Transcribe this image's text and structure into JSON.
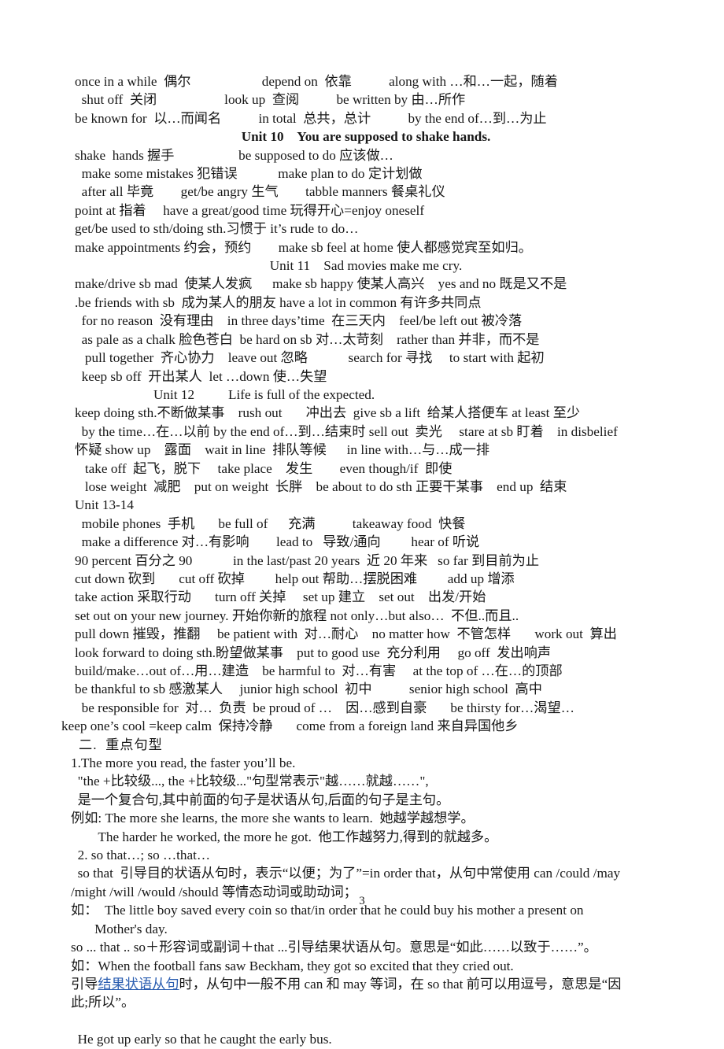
{
  "document": {
    "page_number": "3",
    "link_color": "#2a5db0",
    "text_color": "#171717"
  },
  "lines": [
    {
      "id": "l1",
      "text": "once in a while  偶尔                     depend on  依靠           along with …和…一起，随着"
    },
    {
      "id": "l2",
      "text": "  shut off  关闭                    look up  查阅           be written by 由…所作"
    },
    {
      "id": "l3",
      "text": "be known for  以…而闻名           in total  总共，总计           by the end of…到…为止"
    },
    {
      "id": "l4",
      "text": "Unit 10    You are supposed to shake hands."
    },
    {
      "id": "l5",
      "text": "shake  hands 握手                   be supposed to do 应该做…"
    },
    {
      "id": "l6",
      "text": "  make some mistakes 犯错误            make plan to do 定计划做"
    },
    {
      "id": "l7",
      "text": "  after all 毕竟        get/be angry 生气        tabble manners 餐桌礼仪"
    },
    {
      "id": "l8",
      "text": "point at 指着     have a great/good time 玩得开心=enjoy oneself"
    },
    {
      "id": "l9",
      "text": "get/be used to sth/doing sth.习惯于 it’s rude to do…"
    },
    {
      "id": "l10",
      "text": "make appointments 约会，预约        make sb feel at home 使人都感觉宾至如归。"
    },
    {
      "id": "l11",
      "text": "Unit 11    Sad movies make me cry."
    },
    {
      "id": "l12",
      "text": "make/drive sb mad  使某人发疯      make sb happy 使某人高兴    yes and no 既是又不是"
    },
    {
      "id": "l13",
      "text": ".be friends with sb  成为某人的朋友 have a lot in common 有许多共同点"
    },
    {
      "id": "l14",
      "text": "  for no reason  没有理由    in three days’time  在三天内    feel/be left out 被冷落"
    },
    {
      "id": "l15",
      "text": "  as pale as a chalk 脸色苍白  be hard on sb 对…太苛刻    rather than 并非，而不是"
    },
    {
      "id": "l16",
      "text": "   pull together  齐心协力    leave out 忽略            search for 寻找     to start with 起初"
    },
    {
      "id": "l17",
      "text": "  keep sb off  开出某人  let …down 使…失望"
    },
    {
      "id": "l18",
      "text": "Unit 12          Life is full of the expected."
    },
    {
      "id": "l19",
      "text": "keep doing sth.不断做某事    rush out       冲出去  give sb a lift  给某人搭便车 at least 至少"
    },
    {
      "id": "l20",
      "text": "  by the time…在…以前 by the end of…到…结束时 sell out  卖光     stare at sb 盯着    in disbelief"
    },
    {
      "id": "l21",
      "text": "怀疑 show up    露面    wait in line  排队等候      in line with…与…成一排"
    },
    {
      "id": "l22",
      "text": "   take off  起飞，脱下     take place    发生        even though/if  即使"
    },
    {
      "id": "l23",
      "text": "   lose weight  减肥    put on weight  长胖    be about to do sth 正要干某事    end up  结束"
    },
    {
      "id": "l24",
      "text": "Unit 13-14"
    },
    {
      "id": "l25",
      "text": "  mobile phones  手机       be full of      充满           takeaway food  快餐"
    },
    {
      "id": "l26",
      "text": "  make a difference 对…有影响        lead to   导致/通向         hear of 听说"
    },
    {
      "id": "l27",
      "text": "90 percent 百分之 90            in the last/past 20 years  近 20 年来   so far 到目前为止"
    },
    {
      "id": "l28",
      "text": "cut down 砍到       cut off 砍掉         help out 帮助…摆脱困难         add up 增添"
    },
    {
      "id": "l29",
      "text": "take action 采取行动       turn off 关掉     set up 建立    set out    出发/开始"
    },
    {
      "id": "l30",
      "text": "set out on your new journey. 开始你新的旅程 not only…but also…  不但..而且.."
    },
    {
      "id": "l31",
      "text": "pull down 摧毁，推翻     be patient with  对…耐心    no matter how  不管怎样       work out  算出"
    },
    {
      "id": "l32",
      "text": "look forward to doing sth.盼望做某事    put to good use  充分利用     go off  发出响声"
    },
    {
      "id": "l33",
      "text": "build/make…out of…用…建造    be harmful to  对…有害     at the top of …在…的顶部"
    },
    {
      "id": "l34",
      "text": "be thankful to sb 感激某人     junior high school  初中           senior high school  高中"
    },
    {
      "id": "l35",
      "text": "  be responsible for  对…  负责  be proud of …    因…感到自豪       be thirsty for…渴望…"
    },
    {
      "id": "l36",
      "text": "keep one’s cool =keep calm  保持冷静       come from a foreign land 来自异国他乡"
    },
    {
      "id": "l37",
      "text": "二.  重点句型"
    },
    {
      "id": "l38",
      "text": "1.The more you read, the faster you’ll be."
    },
    {
      "id": "l39",
      "text": "  \"the +比较级..., the +比较级...\"句型常表示\"越……就越……\","
    },
    {
      "id": "l40",
      "text": "  是一个复合句,其中前面的句子是状语从句,后面的句子是主句。"
    },
    {
      "id": "l41",
      "text": "例如: The more she learns, the more she wants to learn.  她越学越想学。"
    },
    {
      "id": "l42",
      "text": "        The harder he worked, the more he got.  他工作越努力,得到的就越多。"
    },
    {
      "id": "l43",
      "text": "  2. so that…; so …that…"
    },
    {
      "id": "l44",
      "text": "  so that  引导目的状语从句时，表示“以便；为了”=in order that，从句中常使用 can /could /may"
    },
    {
      "id": "l45",
      "text": "/might /will /would /should 等情态动词或助动词；"
    },
    {
      "id": "l46",
      "text": "如：  The little boy saved every coin so that/in order that he could buy his mother a present on"
    },
    {
      "id": "l47",
      "text": "       Mother's day."
    },
    {
      "id": "l48",
      "text": "so ... that .. so＋形容词或副词＋that ...引导结果状语从句。意思是“如此……以致于……”。"
    },
    {
      "id": "l49",
      "text": "如：When the football fans saw Beckham, they got so excited that they cried out."
    },
    {
      "id": "l50a",
      "text": "引导"
    },
    {
      "id": "l50b_link",
      "text": "结果状语从句"
    },
    {
      "id": "l50c",
      "text": "时，从句中一般不用 can 和 may 等词，在 so that 前可以用逗号，意思是“因"
    },
    {
      "id": "l51",
      "text": "此;所以”。"
    },
    {
      "id": "l52",
      "text": "  He got up early so that he caught the early bus."
    }
  ]
}
